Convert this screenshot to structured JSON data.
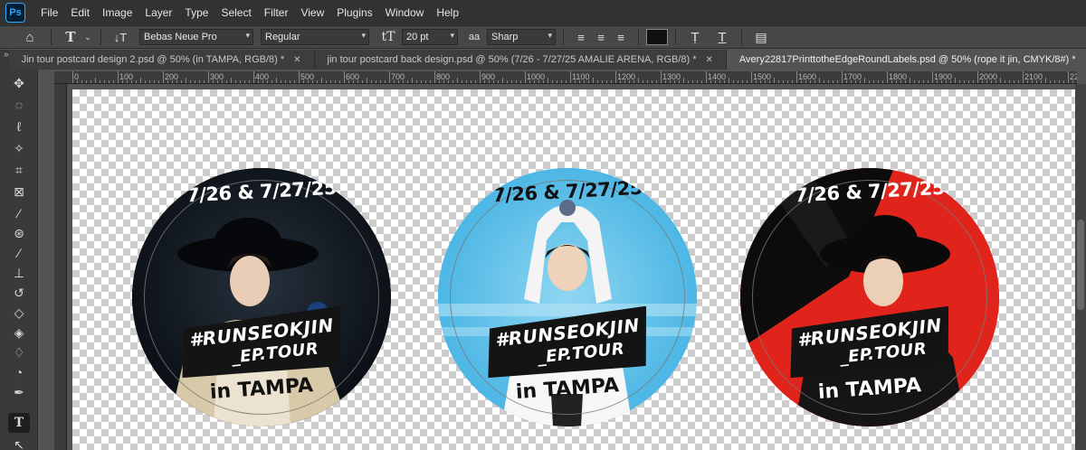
{
  "app": {
    "logo": "Ps"
  },
  "menu": [
    "File",
    "Edit",
    "Image",
    "Layer",
    "Type",
    "Select",
    "Filter",
    "View",
    "Plugins",
    "Window",
    "Help"
  ],
  "options": {
    "font_family": "Bebas Neue Pro",
    "font_style": "Regular",
    "font_size": "20 pt",
    "aa_label": "aa",
    "antialias": "Sharp",
    "text_color": "#111111"
  },
  "tabs": [
    {
      "label": "Jin tour postcard design 2.psd @ 50% (in TAMPA, RGB/8) *",
      "active": false
    },
    {
      "label": "jin tour postcard back design.psd @ 50% (7/26 - 7/27/25 AMALIE ARENA, RGB/8) *",
      "active": false
    },
    {
      "label": "Avery22817PrinttotheEdgeRoundLabels.psd @ 50% (rope it jin, CMYK/8#) *",
      "active": true
    }
  ],
  "ruler": [
    "0",
    "100",
    "200",
    "300",
    "400",
    "500",
    "600",
    "700",
    "800",
    "900",
    "1000",
    "1100",
    "1200",
    "1300",
    "1400",
    "1500",
    "1600",
    "1700",
    "1800",
    "1900",
    "2000",
    "2100",
    "2200"
  ],
  "labels": [
    {
      "date": "7/26 & 7/27/25",
      "tag1": "#RUNSEOKJIN",
      "tag2": "_EP.TOUR",
      "city": "in TAMPA",
      "bg": "#0d141c",
      "date_color": "#ffffff"
    },
    {
      "date": "7/26 & 7/27/25",
      "tag1": "#RUNSEOKJIN",
      "tag2": "_EP.TOUR",
      "city": "in TAMPA",
      "bg": "#5bbfe8",
      "date_color": "#111111"
    },
    {
      "date": "7/26 & 7/27/25",
      "tag1": "#RUNSEOKJIN",
      "tag2": "_EP.TOUR",
      "city": "in TAMPA",
      "bg": "#e0241b",
      "date_color": "#ffffff"
    }
  ]
}
